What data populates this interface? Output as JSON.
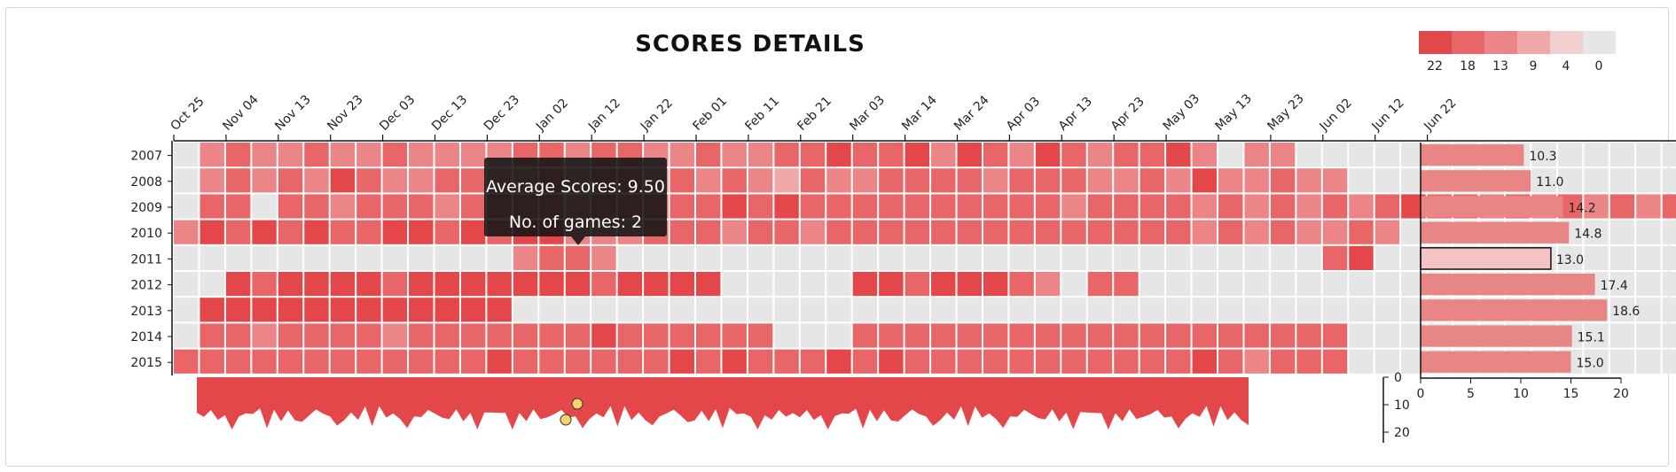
{
  "title": "SCORES DETAILS",
  "colors": {
    "scale": [
      "#e3474a",
      "#e86667",
      "#ec8587",
      "#eea8a9",
      "#f1cfd0",
      "#e6e6e6"
    ],
    "empty": "#e6e6e6",
    "area": "#e3474a",
    "marker": "#f5d36b",
    "bar": "#e88585",
    "bar_highlight": "#f4c3c4"
  },
  "legend": {
    "labels": [
      "22",
      "18",
      "13",
      "9",
      "4",
      "0"
    ]
  },
  "tooltip": {
    "line1": "Average Scores: 9.50",
    "line2": "No. of games: 2"
  },
  "chart_data": {
    "type": "heatmap",
    "title": "SCORES DETAILS",
    "x_ticks": [
      "Oct 25",
      "Nov 04",
      "Nov 13",
      "Nov 23",
      "Dec 03",
      "Dec 13",
      "Dec 23",
      "Jan 02",
      "Jan 12",
      "Jan 22",
      "Feb 01",
      "Feb 11",
      "Feb 21",
      "Mar 03",
      "Mar 14",
      "Mar 24",
      "Apr 03",
      "Apr 13",
      "Apr 23",
      "May 03",
      "May 13",
      "May 23",
      "Jun 02",
      "Jun 12",
      "Jun 22"
    ],
    "seasons": [
      "2007",
      "2008",
      "2009",
      "2010",
      "2011",
      "2012",
      "2013",
      "2014",
      "2015"
    ],
    "levels": [
      [
        0,
        3,
        2,
        3,
        3,
        2,
        3,
        3,
        2,
        3,
        3,
        3,
        3,
        2,
        2,
        3,
        2,
        2,
        3,
        3,
        2,
        3,
        3,
        2,
        2,
        1,
        2,
        2,
        1,
        3,
        1,
        2,
        3,
        1,
        2,
        3,
        2,
        2,
        1,
        3,
        0,
        3,
        3,
        0,
        0,
        0,
        0,
        0,
        0,
        0,
        0,
        0,
        0,
        0,
        0,
        0,
        0,
        0,
        0,
        0,
        0,
        0,
        0,
        0,
        0,
        0,
        0,
        0,
        0,
        0,
        0
      ],
      [
        0,
        3,
        2,
        3,
        2,
        3,
        1,
        2,
        3,
        3,
        2,
        2,
        3,
        3,
        2,
        3,
        2,
        2,
        3,
        2,
        3,
        2,
        3,
        4,
        2,
        3,
        3,
        2,
        2,
        2,
        2,
        3,
        2,
        2,
        2,
        3,
        3,
        2,
        3,
        1,
        3,
        3,
        2,
        3,
        3,
        0,
        0,
        0,
        0,
        0,
        0,
        0,
        0,
        0,
        0,
        0,
        0,
        0,
        0,
        0,
        0,
        0,
        0,
        0,
        0,
        0,
        0,
        0,
        0,
        0,
        0
      ],
      [
        0,
        2,
        2,
        0,
        2,
        2,
        3,
        2,
        2,
        2,
        3,
        2,
        2,
        2,
        2,
        3,
        2,
        2,
        2,
        2,
        2,
        1,
        2,
        1,
        2,
        2,
        2,
        2,
        2,
        2,
        2,
        2,
        2,
        2,
        3,
        2,
        2,
        2,
        2,
        3,
        2,
        3,
        2,
        3,
        2,
        3,
        2,
        1,
        2,
        2,
        3,
        2,
        3,
        2,
        3,
        2,
        3,
        2,
        2,
        2,
        0,
        0,
        0,
        0,
        0,
        0,
        0,
        0,
        0,
        0,
        0
      ],
      [
        3,
        1,
        2,
        1,
        2,
        1,
        2,
        2,
        1,
        1,
        2,
        1,
        2,
        1,
        1,
        3,
        3,
        3,
        2,
        2,
        2,
        3,
        2,
        2,
        3,
        2,
        2,
        2,
        2,
        2,
        2,
        2,
        2,
        2,
        2,
        2,
        2,
        2,
        2,
        3,
        2,
        3,
        2,
        3,
        3,
        2,
        3,
        0,
        0,
        0,
        0,
        0,
        0,
        0,
        0,
        0,
        0,
        0,
        0,
        0,
        0,
        0,
        0,
        0,
        0,
        0,
        0,
        0,
        0,
        0,
        0
      ],
      [
        0,
        0,
        0,
        0,
        0,
        0,
        0,
        0,
        0,
        0,
        0,
        0,
        0,
        3,
        2,
        2,
        3,
        0,
        0,
        0,
        0,
        0,
        0,
        0,
        0,
        0,
        0,
        0,
        0,
        0,
        0,
        0,
        0,
        0,
        0,
        0,
        0,
        0,
        0,
        0,
        0,
        0,
        0,
        0,
        2,
        1,
        0,
        0,
        0,
        0,
        0,
        0,
        0,
        0,
        0,
        0,
        0,
        0,
        0,
        0,
        0,
        0,
        0,
        0,
        0,
        0,
        0,
        0,
        0,
        0,
        0
      ],
      [
        0,
        0,
        1,
        2,
        1,
        1,
        1,
        1,
        2,
        1,
        1,
        1,
        1,
        1,
        1,
        1,
        2,
        1,
        1,
        1,
        1,
        0,
        0,
        0,
        0,
        0,
        1,
        1,
        2,
        1,
        1,
        1,
        2,
        3,
        0,
        2,
        2,
        0,
        0,
        0,
        0,
        0,
        0,
        0,
        0,
        0,
        0,
        0,
        0,
        0,
        0,
        0,
        0,
        0,
        0,
        0,
        0,
        0,
        0,
        0,
        0,
        0,
        0,
        0,
        0,
        0,
        0,
        0,
        0,
        0,
        0
      ],
      [
        0,
        1,
        1,
        1,
        1,
        1,
        1,
        1,
        1,
        1,
        1,
        1,
        1,
        0,
        0,
        0,
        0,
        0,
        0,
        0,
        0,
        0,
        0,
        0,
        0,
        0,
        0,
        0,
        0,
        0,
        0,
        0,
        0,
        0,
        0,
        0,
        0,
        0,
        0,
        0,
        0,
        0,
        0,
        0,
        0,
        0,
        0,
        0,
        0,
        0,
        0,
        0,
        0,
        0,
        0,
        0,
        0,
        0,
        0,
        0,
        0,
        0,
        0,
        0,
        0,
        0,
        0,
        0,
        0,
        0,
        0
      ],
      [
        0,
        2,
        2,
        3,
        2,
        2,
        2,
        2,
        3,
        2,
        2,
        2,
        2,
        2,
        2,
        2,
        1,
        2,
        2,
        2,
        2,
        2,
        2,
        0,
        0,
        0,
        2,
        2,
        2,
        2,
        2,
        2,
        2,
        2,
        2,
        2,
        2,
        2,
        2,
        2,
        2,
        2,
        2,
        2,
        2,
        0,
        0,
        0,
        0,
        0,
        0,
        0,
        0,
        0,
        0,
        0,
        0,
        0,
        0,
        0,
        0,
        0,
        0,
        0,
        0,
        0,
        0,
        0,
        0,
        0,
        0
      ],
      [
        2,
        2,
        2,
        2,
        2,
        2,
        2,
        2,
        2,
        2,
        2,
        2,
        1,
        2,
        2,
        2,
        2,
        2,
        2,
        1,
        2,
        1,
        2,
        2,
        2,
        1,
        2,
        1,
        2,
        2,
        2,
        2,
        2,
        2,
        2,
        2,
        2,
        2,
        2,
        1,
        2,
        3,
        2,
        2,
        2,
        0,
        0,
        0,
        0,
        0,
        0,
        0,
        0,
        0,
        0,
        0,
        0,
        0,
        0,
        0,
        0,
        0,
        0,
        0,
        0,
        0,
        0,
        0,
        0,
        0,
        0
      ]
    ],
    "season_avg": {
      "values": [
        10.3,
        11.0,
        14.2,
        14.8,
        13.0,
        17.4,
        18.6,
        15.1,
        15.0
      ],
      "xlim": [
        0,
        20
      ],
      "x_ticks": [
        "0",
        "5",
        "10",
        "15",
        "20"
      ],
      "highlight_index": 4
    },
    "daily_area": {
      "ylim": [
        0,
        20
      ],
      "y_ticks": [
        "0",
        "10",
        "20"
      ]
    }
  }
}
